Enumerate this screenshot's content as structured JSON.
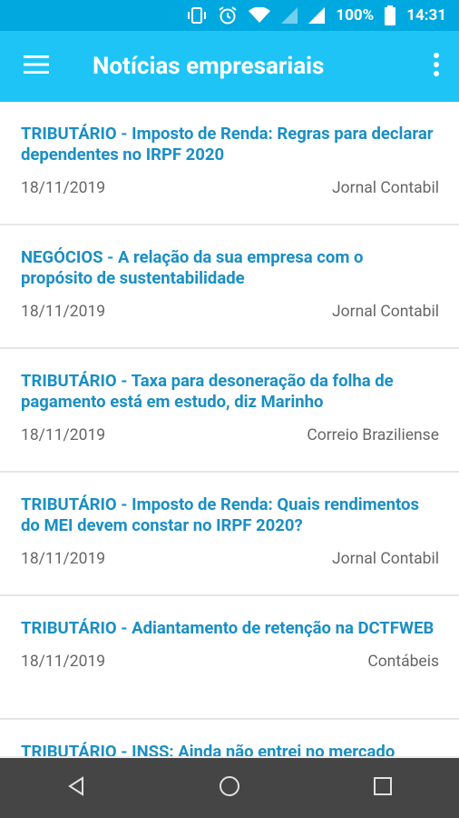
{
  "status_bar": {
    "battery": "100%",
    "time": "14:31"
  },
  "appbar": {
    "title": "Notícias empresariais"
  },
  "news": [
    {
      "headline": "TRIBUTÁRIO - Imposto de Renda: Regras para declarar dependentes no IRPF 2020",
      "date": "18/11/2019",
      "source": "Jornal Contabil"
    },
    {
      "headline": "NEGÓCIOS - A relação da sua empresa com o propósito de sustentabilidade",
      "date": "18/11/2019",
      "source": "Jornal Contabil"
    },
    {
      "headline": "TRIBUTÁRIO - Taxa para desoneração da folha de pagamento está em estudo, diz Marinho",
      "date": "18/11/2019",
      "source": "Correio Braziliense"
    },
    {
      "headline": "TRIBUTÁRIO - Imposto de Renda: Quais rendimentos do MEI devem constar no IRPF 2020?",
      "date": "18/11/2019",
      "source": "Jornal Contabil"
    },
    {
      "headline": "TRIBUTÁRIO - Adiantamento de retenção na DCTFWEB",
      "date": "18/11/2019",
      "source": "Contábeis"
    },
    {
      "headline": "TRIBUTÁRIO - INSS: Ainda não entrei no mercado",
      "date": "",
      "source": ""
    }
  ]
}
